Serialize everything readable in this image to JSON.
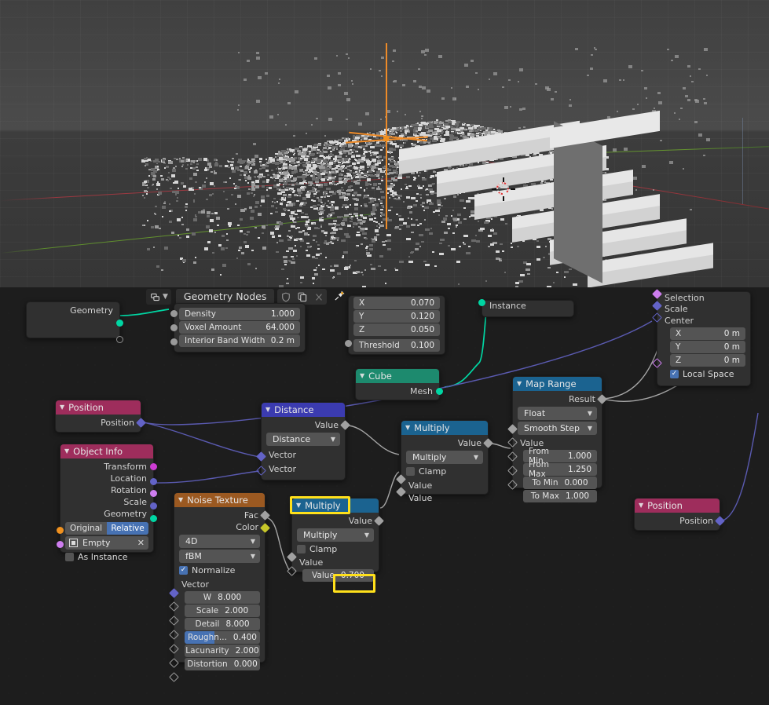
{
  "app": "Blender",
  "viewport": {
    "name": "3d-viewport",
    "objects": [
      "voxel-point-cloud",
      "stairs-mesh",
      "empty-plain-axes",
      "3d-cursor"
    ]
  },
  "node_editor": {
    "header": {
      "editor_type_icon": "geometry-nodes-editor-icon",
      "chevron_icon": "chevron-down-icon",
      "title": "Geometry Nodes",
      "shield_icon": "shield-icon",
      "copy_icon": "new-node-group-icon",
      "close_icon": "unlink-icon",
      "pin_icon": "pin-icon"
    },
    "nodes": [
      {
        "id": "group-input",
        "title": "",
        "outputs": [
          {
            "label": "Geometry",
            "socket": "geometry-socket",
            "color": "#00d6a3"
          }
        ],
        "extra_socket": "virtual-socket"
      },
      {
        "id": "points-to-volume",
        "title": "",
        "fields": [
          {
            "label": "Density",
            "value": "1.000"
          },
          {
            "label": "Voxel Amount",
            "value": "64.000"
          },
          {
            "label": "Interior Band Width",
            "value": "0.2 m"
          }
        ]
      },
      {
        "id": "volume-to-mesh",
        "title": "",
        "fields": [
          {
            "label": "X",
            "value": "0.070"
          },
          {
            "label": "Y",
            "value": "0.120"
          },
          {
            "label": "Z",
            "value": "0.050"
          },
          {
            "label": "Threshold",
            "value": "0.100"
          }
        ]
      },
      {
        "id": "instance-on-points",
        "title": "",
        "inputs": [
          {
            "label": "Instance",
            "socket": "geometry-socket",
            "color": "#00d6a3"
          }
        ]
      },
      {
        "id": "scale-elements",
        "title": "",
        "inputs": [
          {
            "label": "Selection",
            "socket": "boolean-socket",
            "color": "#cd7dee"
          },
          {
            "label": "Scale",
            "socket": "float-socket",
            "color": "#6363c7"
          },
          {
            "label": "Center",
            "socket": "vector-socket",
            "color": "#6363c7"
          }
        ],
        "fields": [
          {
            "label": "X",
            "value": "0 m"
          },
          {
            "label": "Y",
            "value": "0 m"
          },
          {
            "label": "Z",
            "value": "0 m"
          }
        ],
        "checkbox": {
          "label": "Local Space",
          "checked": true
        }
      },
      {
        "id": "cube",
        "title": "Cube",
        "header_color": "#1d8a6e",
        "outputs": [
          {
            "label": "Mesh",
            "socket": "geometry-socket",
            "color": "#00d6a3"
          }
        ]
      },
      {
        "id": "position-top",
        "title": "Position",
        "header_color": "#9e2d5c",
        "outputs": [
          {
            "label": "Position",
            "socket": "vector-socket",
            "color": "#6363c7"
          }
        ]
      },
      {
        "id": "object-info",
        "title": "Object Info",
        "header_color": "#9e2d5c",
        "outputs": [
          {
            "label": "Transform",
            "color": "#cd3cd3"
          },
          {
            "label": "Location",
            "color": "#6363c7"
          },
          {
            "label": "Rotation",
            "color": "#cd7dee"
          },
          {
            "label": "Scale",
            "color": "#6363c7"
          },
          {
            "label": "Geometry",
            "color": "#00d6a3"
          }
        ],
        "segmented": {
          "options": [
            "Original",
            "Relative"
          ],
          "selected": "Relative"
        },
        "object_field": {
          "icon": "object-icon",
          "value": "Empty",
          "close_icon": "x-icon"
        },
        "checkbox": {
          "label": "As Instance",
          "checked": false
        }
      },
      {
        "id": "noise-texture",
        "title": "Noise Texture",
        "header_color": "#9b5921",
        "outputs": [
          {
            "label": "Fac",
            "color": "#a1a1a1"
          },
          {
            "label": "Color",
            "color": "#c7c729"
          }
        ],
        "dropdowns": [
          "4D",
          "fBM"
        ],
        "checkbox": {
          "label": "Normalize",
          "checked": true
        },
        "inputs": [
          {
            "label": "Vector",
            "color": "#6363c7"
          }
        ],
        "fields": [
          {
            "label": "W",
            "value": "8.000"
          },
          {
            "label": "Scale",
            "value": "2.000"
          },
          {
            "label": "Detail",
            "value": "8.000"
          },
          {
            "label": "Roughn...",
            "value": "0.400",
            "slider": 0.4
          },
          {
            "label": "Lacunarity",
            "value": "2.000"
          },
          {
            "label": "Distortion",
            "value": "0.000"
          }
        ]
      },
      {
        "id": "distance",
        "title": "Distance",
        "header_color": "#3b3bb0",
        "outputs": [
          {
            "label": "Value",
            "color": "#a1a1a1"
          }
        ],
        "dropdowns": [
          "Distance"
        ],
        "inputs": [
          {
            "label": "Vector",
            "color": "#6363c7"
          },
          {
            "label": "Vector",
            "color": "#6363c7",
            "hollow": true
          }
        ]
      },
      {
        "id": "multiply-upper",
        "title": "Multiply",
        "header_color": "#1b6390",
        "outputs": [
          {
            "label": "Value",
            "color": "#a1a1a1"
          }
        ],
        "dropdowns": [
          "Multiply"
        ],
        "checkbox": {
          "label": "Clamp",
          "checked": false
        },
        "inputs": [
          {
            "label": "Value",
            "color": "#a1a1a1"
          },
          {
            "label": "Value",
            "color": "#a1a1a1"
          }
        ]
      },
      {
        "id": "multiply-lower",
        "title": "Multiply",
        "header_color": "#1b6390",
        "highlighted": true,
        "outputs": [
          {
            "label": "Value",
            "color": "#a1a1a1"
          }
        ],
        "dropdowns": [
          "Multiply"
        ],
        "checkbox": {
          "label": "Clamp",
          "checked": false
        },
        "inputs": [
          {
            "label": "Value",
            "color": "#a1a1a1"
          }
        ],
        "fields": [
          {
            "label": "Value",
            "value": "0.700",
            "highlighted": true
          }
        ]
      },
      {
        "id": "map-range",
        "title": "Map Range",
        "header_color": "#1b6390",
        "outputs": [
          {
            "label": "Result",
            "color": "#a1a1a1"
          }
        ],
        "dropdowns": [
          "Float",
          "Smooth Step"
        ],
        "inputs": [
          {
            "label": "Value",
            "color": "#a1a1a1"
          }
        ],
        "fields": [
          {
            "label": "From Min",
            "value": "1.000"
          },
          {
            "label": "From Max",
            "value": "1.250"
          },
          {
            "label": "To Min",
            "value": "0.000"
          },
          {
            "label": "To Max",
            "value": "1.000"
          }
        ]
      },
      {
        "id": "position-right",
        "title": "Position",
        "header_color": "#9e2d5c",
        "outputs": [
          {
            "label": "Position",
            "color": "#6363c7"
          }
        ]
      }
    ]
  },
  "colors": {
    "highlight": "#ffe01b",
    "geometry_socket": "#00d6a3",
    "vector_socket": "#6363c7",
    "float_socket": "#a1a1a1",
    "boolean_socket": "#cd7dee",
    "color_socket": "#c7c729",
    "header_input_output": "#9e2d5c",
    "header_converter": "#1b6390",
    "header_texture": "#9b5921",
    "header_geometry": "#1d8a6e",
    "header_vector": "#3b3bb0",
    "accent_blue": "#4772b3"
  }
}
